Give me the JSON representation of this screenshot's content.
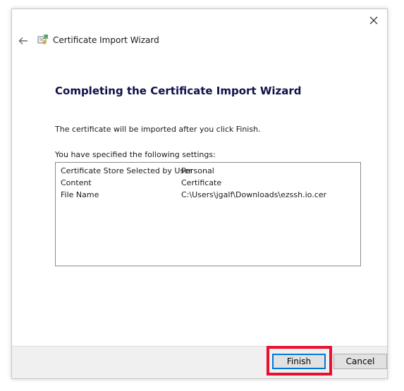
{
  "window": {
    "close_icon": "close-icon",
    "back_icon": "back-arrow-icon",
    "wizard_icon": "certificate-icon",
    "title": "Certificate Import Wizard"
  },
  "page": {
    "heading": "Completing the Certificate Import Wizard",
    "info": "The certificate will be imported after you click Finish.",
    "settings_label": "You have specified the following settings:"
  },
  "settings": [
    {
      "key": "Certificate Store Selected by User",
      "value": "Personal"
    },
    {
      "key": "Content",
      "value": "Certificate"
    },
    {
      "key": "File Name",
      "value": "C:\\Users\\jgalf\\Downloads\\ezssh.io.cer"
    }
  ],
  "footer": {
    "finish_label": "Finish",
    "cancel_label": "Cancel"
  },
  "colors": {
    "highlight": "#e8102e",
    "focus_border": "#0078d7",
    "heading": "#10104a"
  }
}
